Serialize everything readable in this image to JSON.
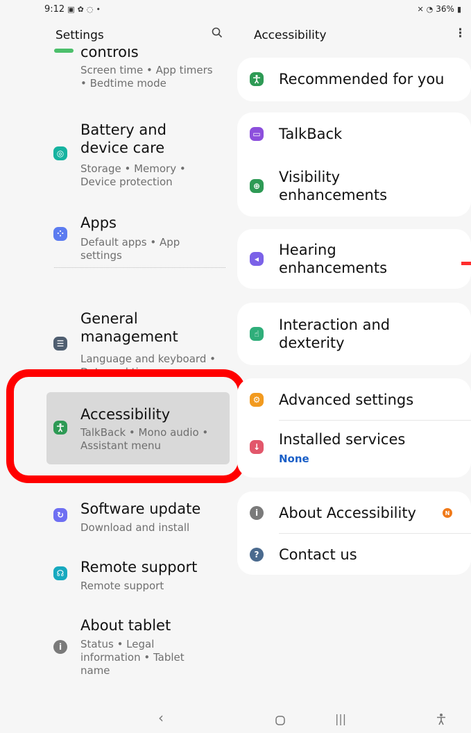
{
  "status_bar": {
    "time": "9:12",
    "icons": [
      "image-icon",
      "gear-icon",
      "sync-icon",
      "dot-icon"
    ],
    "battery": "36%",
    "right_icons": [
      "mute-icon",
      "wifi-icon",
      "battery-icon"
    ]
  },
  "left_pane": {
    "title": "Settings",
    "search_icon": "search-icon",
    "items": [
      {
        "title": "controls",
        "subtitle": "Screen time • App timers • Bedtime mode",
        "icon": "wellbeing-icon",
        "color": "#4cbf6b"
      },
      {
        "title": "Battery and device care",
        "subtitle": "Storage • Memory • Device protection",
        "icon": "device-care-icon",
        "color": "#16b3a0"
      },
      {
        "title": "Apps",
        "subtitle": "Default apps • App settings",
        "icon": "apps-icon",
        "color": "#5c7cf0"
      },
      {
        "title": "General management",
        "subtitle": "Language and keyboard • Date and time",
        "icon": "general-management-icon",
        "color": "#4f5e70"
      },
      {
        "title": "Accessibility",
        "subtitle": "TalkBack • Mono audio • Assistant menu",
        "icon": "accessibility-icon",
        "color": "#2e9a55"
      },
      {
        "title": "Software update",
        "subtitle": "Download and install",
        "icon": "software-update-icon",
        "color": "#6e6ff2"
      },
      {
        "title": "Remote support",
        "subtitle": "Remote support",
        "icon": "remote-support-icon",
        "color": "#17a9bf"
      },
      {
        "title": "About tablet",
        "subtitle": "Status • Legal information • Tablet name",
        "icon": "about-tablet-icon",
        "color": "#7a7a7a"
      }
    ]
  },
  "right_pane": {
    "title": "Accessibility",
    "more_icon": "more-icon",
    "items": [
      {
        "title": "Recommended for you",
        "icon": "recommended-icon",
        "color": "#2e9a55"
      },
      {
        "title": "TalkBack",
        "icon": "talkback-icon",
        "color": "#8c4fdc"
      },
      {
        "title": "Visibility enhancements",
        "icon": "visibility-icon",
        "color": "#2e9a55"
      },
      {
        "title": "Hearing enhancements",
        "icon": "hearing-icon",
        "color": "#7b62e8"
      },
      {
        "title": "Interaction and dexterity",
        "icon": "interaction-icon",
        "color": "#2fae7a"
      },
      {
        "title": "Advanced settings",
        "icon": "advanced-settings-icon",
        "color": "#f29a1f"
      },
      {
        "title": "Installed services",
        "subtitle": "None",
        "icon": "installed-services-icon",
        "color": "#e2576b"
      },
      {
        "title": "About Accessibility",
        "badge": "N",
        "icon": "about-accessibility-icon",
        "color": "#7a7a7a"
      },
      {
        "title": "Contact us",
        "icon": "contact-us-icon",
        "color": "#4a6a8e"
      }
    ]
  },
  "nav_bar": {
    "back": "back-icon",
    "home": "home-icon",
    "recents": "recents-icon",
    "accessibility": "accessibility-shortcut-icon"
  },
  "colors": {
    "highlight": "#d9d9d9",
    "annotation_red": "#ff0000",
    "link_blue": "#1a5fc7",
    "badge_orange": "#f07a1a"
  }
}
